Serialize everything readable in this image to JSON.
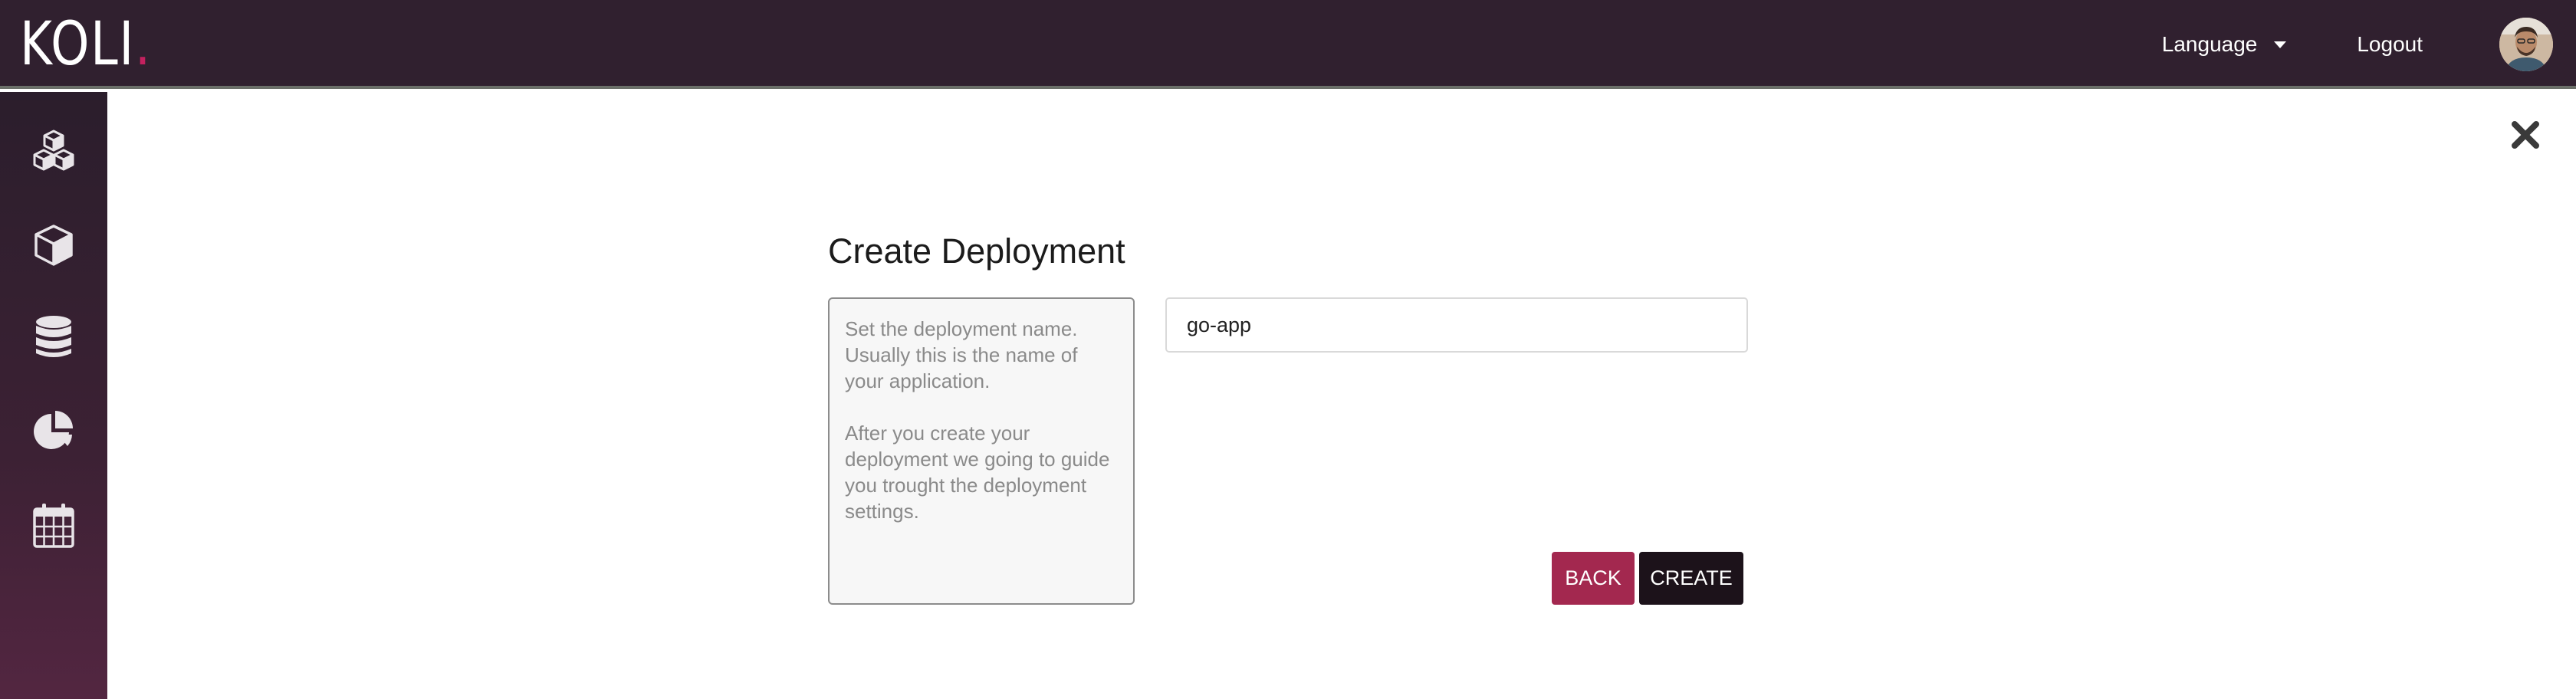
{
  "header": {
    "logo_text": "KOLI",
    "logo_dot": ".",
    "language_label": "Language",
    "logout_label": "Logout"
  },
  "sidebar": {
    "items": [
      {
        "icon": "cubes-icon"
      },
      {
        "icon": "cube-icon"
      },
      {
        "icon": "database-icon"
      },
      {
        "icon": "pie-chart-icon"
      },
      {
        "icon": "calendar-icon"
      }
    ]
  },
  "form": {
    "title": "Create Deployment",
    "help_paragraph_1": "Set the deployment name. Usually this is the name of your application.",
    "help_paragraph_2": "After you create your deployment we going to guide you trought the deployment settings.",
    "name_value": "go-app",
    "back_label": "BACK",
    "create_label": "CREATE"
  },
  "colors": {
    "header_bg": "#30202f",
    "sidebar_bg": "#3c2134",
    "accent": "#a3284f",
    "create_bg": "#1c121a",
    "logo_dot": "#c3215f"
  }
}
